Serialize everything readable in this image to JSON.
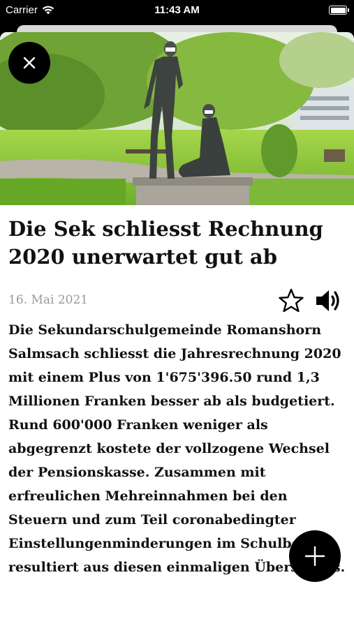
{
  "status_bar": {
    "carrier": "Carrier",
    "time": "11:43 AM",
    "icons": [
      "wifi-icon",
      "battery-icon"
    ]
  },
  "article": {
    "image_icon": "statue-photo",
    "title": "Die Sek schliesst Rechnung 2020 unerwartet gut ab",
    "date": "16. Mai 2021",
    "body": "Die Sekundarschulgemeinde Romanshorn Salmsach schliesst die Jahresrechnung 2020 mit einem Plus von 1'675'396.50 rund 1,3 Millionen Franken besser ab als budgetiert. Rund 600'000 Franken weniger als abgegrenzt kostete der vollzogene Wechsel der Pensionskasse. Zusammen mit erfreulichen Mehreinnahmen bei den Steuern und zum Teil coronabedingter Einstellungenminderungen im Schulbetrieb resultiert aus diesen einmaligen Überschuss."
  },
  "actions": {
    "close_icon": "close-icon",
    "favorite_icon": "star-icon",
    "audio_icon": "speaker-icon",
    "add_icon": "plus-icon"
  },
  "colors": {
    "background": "#000000",
    "sheet": "#ffffff",
    "text": "#111111",
    "date": "#999999",
    "button": "#000000"
  }
}
